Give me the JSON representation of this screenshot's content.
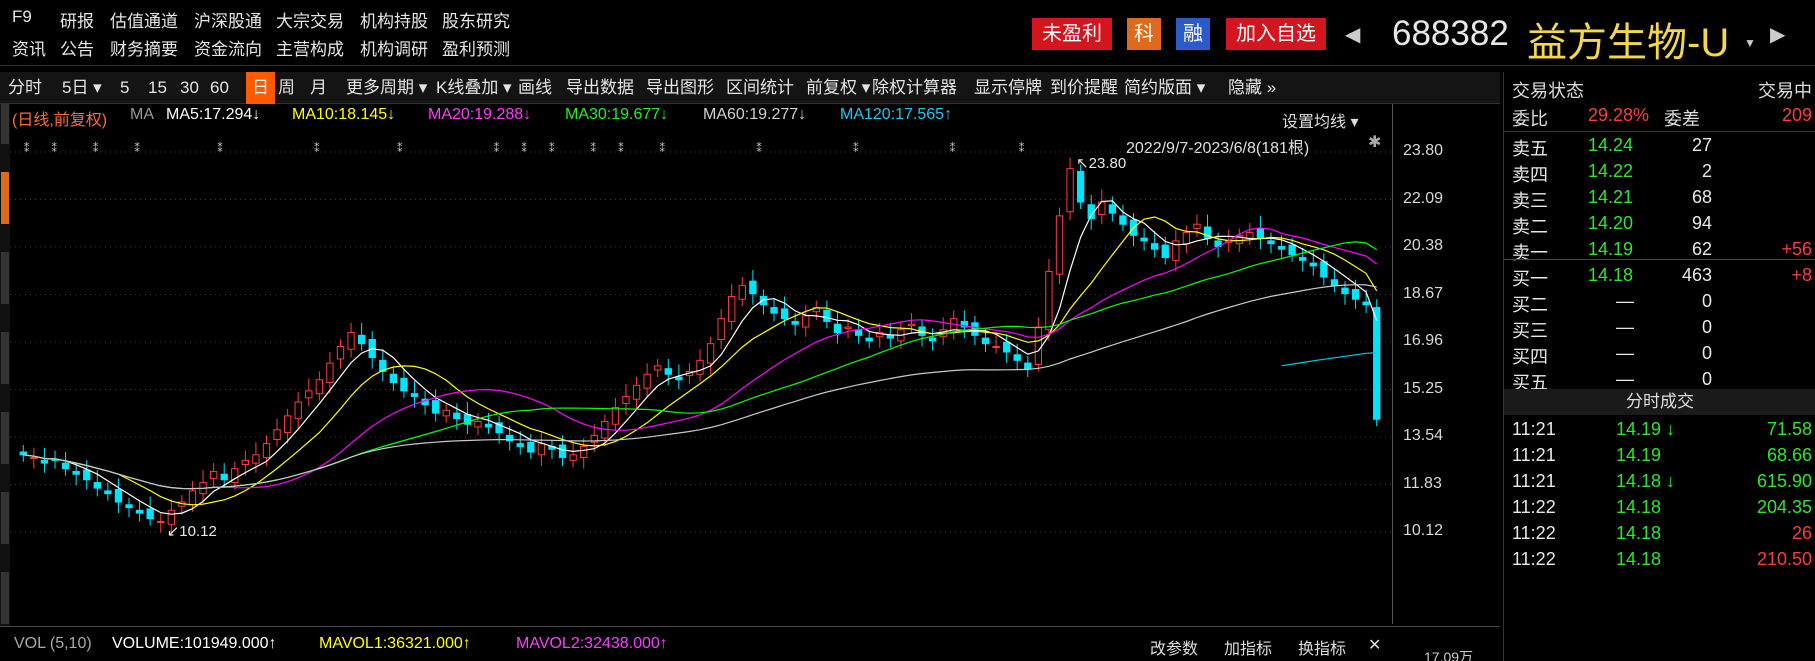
{
  "top_nav": {
    "row1": [
      "F9",
      "研报",
      "估值通道",
      "沪深股通",
      "大宗交易",
      "机构持股",
      "股东研究"
    ],
    "row2": [
      "资讯",
      "公告",
      "财务摘要",
      "资金流向",
      "主营构成",
      "机构调研",
      "盈利预测"
    ]
  },
  "badges": {
    "unprofitable": "未盈利",
    "star": "科",
    "margin": "融",
    "add_watch": "加入自选"
  },
  "stock": {
    "code": "688382",
    "name": "益方生物-U"
  },
  "toolbar": {
    "items": [
      "分时",
      "5日",
      "5",
      "15",
      "30",
      "60",
      "日",
      "周",
      "月",
      "更多周期",
      "K线叠加",
      "画线",
      "导出数据",
      "导出图形",
      "区间统计",
      "前复权",
      "除权计算器",
      "显示停牌",
      "到价提醒",
      "简约版面",
      "隐藏"
    ],
    "selected": "日"
  },
  "ma_line": {
    "prefix": "(日线,前复权)",
    "ma": "MA",
    "ma5": "MA5:17.294↓",
    "ma10": "MA10:18.145↓",
    "ma20": "MA20:19.288↓",
    "ma30": "MA30:19.677↓",
    "ma60": "MA60:19.277↓",
    "ma120": "MA120:17.565↑",
    "settings": "设置均线",
    "range": "2022/9/7-2023/6/8(181根)"
  },
  "colors": {
    "up": "#ff3b3b",
    "down": "#00e5ff",
    "ma5": "#ffffff",
    "ma10": "#ffff00",
    "ma20": "#ff00ff",
    "ma30": "#00ff00",
    "ma60": "#c8c8c8",
    "ma120": "#00c8e8"
  },
  "chart_data": {
    "type": "candlestick",
    "y_ticks": [
      "23.80",
      "22.09",
      "20.38",
      "18.67",
      "16.96",
      "15.25",
      "13.54",
      "11.83",
      "10.12"
    ],
    "ylim": [
      10.12,
      23.8
    ],
    "annotations": {
      "high": "23.80",
      "low": "10.12"
    },
    "closes": [
      12.9,
      12.8,
      12.6,
      12.7,
      12.4,
      12.2,
      12.0,
      11.7,
      11.5,
      11.2,
      11.0,
      10.8,
      10.6,
      10.5,
      10.9,
      11.2,
      11.6,
      11.9,
      12.3,
      12.0,
      12.4,
      12.7,
      12.9,
      13.3,
      13.8,
      14.3,
      14.8,
      15.2,
      15.6,
      16.2,
      16.8,
      17.3,
      16.9,
      16.4,
      15.9,
      15.5,
      15.2,
      15.0,
      14.7,
      14.4,
      14.5,
      14.2,
      14.0,
      14.1,
      13.9,
      13.7,
      13.4,
      13.2,
      13.0,
      13.3,
      13.1,
      12.8,
      12.9,
      13.2,
      13.6,
      14.1,
      14.6,
      15.0,
      15.4,
      15.8,
      16.1,
      15.8,
      15.6,
      15.9,
      16.3,
      16.9,
      17.8,
      18.6,
      19.0,
      18.7,
      18.3,
      18.0,
      17.8,
      17.6,
      17.9,
      18.2,
      17.7,
      17.3,
      17.5,
      17.2,
      17.0,
      17.3,
      17.1,
      17.4,
      17.6,
      17.2,
      17.0,
      17.4,
      17.8,
      17.5,
      17.2,
      16.9,
      16.8,
      16.6,
      16.3,
      16.0,
      17.5,
      19.5,
      21.5,
      23.2,
      22.0,
      21.4,
      22.0,
      21.6,
      21.2,
      20.8,
      20.6,
      20.3,
      20.0,
      20.6,
      20.9,
      21.2,
      20.7,
      20.4,
      20.6,
      20.8,
      20.9,
      20.7,
      20.5,
      20.3,
      20.1,
      19.9,
      19.7,
      19.3,
      19.0,
      18.7,
      18.5,
      18.3,
      14.18
    ]
  },
  "volume": {
    "label": "VOL (5,10)",
    "volume": "VOLUME:101949.000↑",
    "mavol1": "MAVOL1:36321.000↑",
    "mavol2": "MAVOL2:32438.000↑",
    "btn_params": "改参数",
    "btn_add": "加指标",
    "btn_switch": "换指标",
    "close": "✕",
    "axis_cut": "17.09万"
  },
  "panel": {
    "status_label": "交易状态",
    "status_value": "交易中",
    "wb_label": "委比",
    "wb_value": "29.28%",
    "wc_label": "委差",
    "wc_value": "209",
    "asks": [
      {
        "label": "卖五",
        "price": "14.24",
        "vol": "27",
        "chg": ""
      },
      {
        "label": "卖四",
        "price": "14.22",
        "vol": "2",
        "chg": ""
      },
      {
        "label": "卖三",
        "price": "14.21",
        "vol": "68",
        "chg": ""
      },
      {
        "label": "卖二",
        "price": "14.20",
        "vol": "94",
        "chg": ""
      },
      {
        "label": "卖一",
        "price": "14.19",
        "vol": "62",
        "chg": "+56"
      }
    ],
    "bids": [
      {
        "label": "买一",
        "price": "14.18",
        "vol": "463",
        "chg": "+8"
      },
      {
        "label": "买二",
        "price": "—",
        "vol": "0",
        "chg": ""
      },
      {
        "label": "买三",
        "price": "—",
        "vol": "0",
        "chg": ""
      },
      {
        "label": "买四",
        "price": "—",
        "vol": "0",
        "chg": ""
      },
      {
        "label": "买五",
        "price": "—",
        "vol": "0",
        "chg": ""
      }
    ],
    "trades_title": "分时成交",
    "trades": [
      {
        "time": "11:21",
        "price": "14.19 ↓",
        "vol": "71.58",
        "vcolor": "green"
      },
      {
        "time": "11:21",
        "price": "14.19",
        "vol": "68.66",
        "vcolor": "green"
      },
      {
        "time": "11:21",
        "price": "14.18 ↓",
        "vol": "615.90",
        "vcolor": "green"
      },
      {
        "time": "11:22",
        "price": "14.18",
        "vol": "204.35",
        "vcolor": "green"
      },
      {
        "time": "11:22",
        "price": "14.18",
        "vol": "26",
        "vcolor": "red"
      },
      {
        "time": "11:22",
        "price": "14.18",
        "vol": "210.50",
        "vcolor": "red"
      }
    ]
  }
}
